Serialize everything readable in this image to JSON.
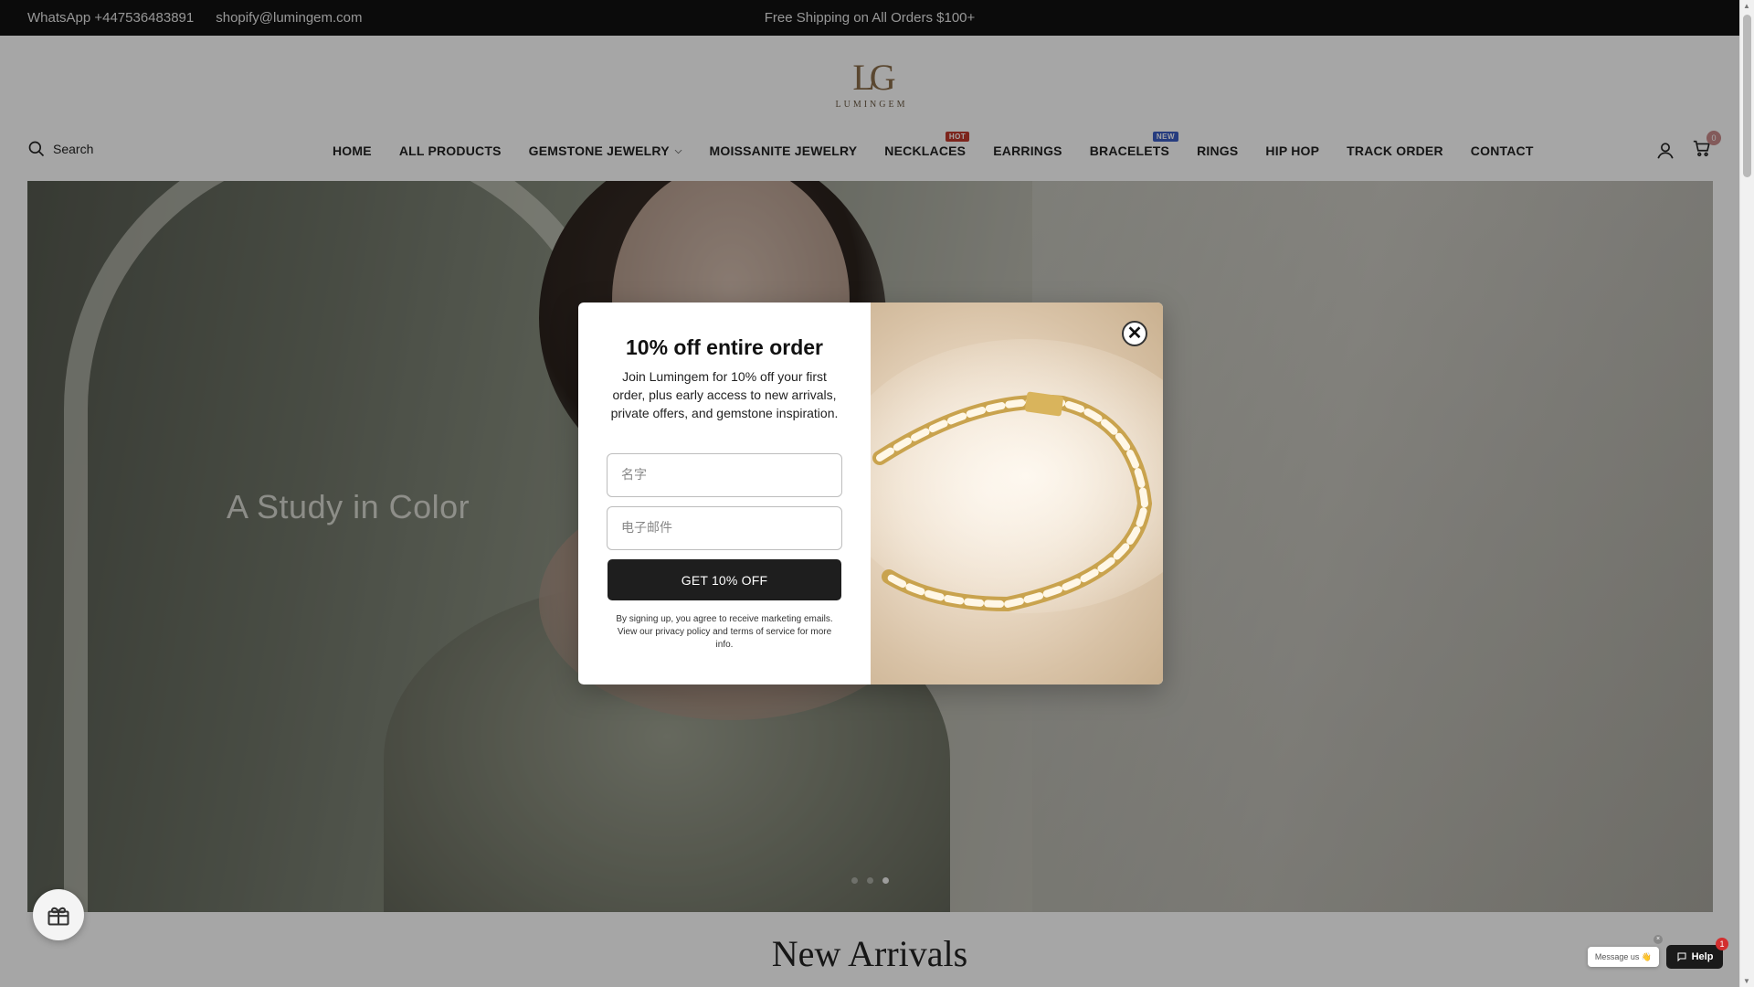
{
  "topbar": {
    "whatsapp": "WhatsApp +447536483891",
    "email": "shopify@lumingem.com",
    "promo": "Free Shipping on All Orders $100+"
  },
  "header": {
    "logo_mark": "LG",
    "logo_word": "LUMINGEM",
    "search_label": "Search",
    "cart_count": "0",
    "nav": [
      {
        "label": "HOME"
      },
      {
        "label": "ALL PRODUCTS"
      },
      {
        "label": "GEMSTONE JEWELRY",
        "dropdown": true
      },
      {
        "label": "MOISSANITE JEWELRY"
      },
      {
        "label": "NECKLACES",
        "badge": "HOT"
      },
      {
        "label": "EARRINGS"
      },
      {
        "label": "BRACELETS",
        "badge": "NEW"
      },
      {
        "label": "RINGS"
      },
      {
        "label": "HIP HOP"
      },
      {
        "label": "TRACK ORDER"
      },
      {
        "label": "CONTACT"
      }
    ]
  },
  "hero": {
    "slogan": "A Study in Color",
    "slides": 3,
    "active_slide": 3
  },
  "popup": {
    "title": "10% off entire order",
    "subtitle": "Join Lumingem for 10% off your first order, plus early access to new arrivals, private offers, and gemstone inspiration.",
    "name_placeholder": "名字",
    "email_placeholder": "电子邮件",
    "cta_label": "GET 10% OFF",
    "legal": "By signing up, you agree to receive marketing emails. View our privacy policy and terms of service for more info.",
    "close_label": "✕"
  },
  "sections": {
    "new_arrivals_title": "New Arrivals"
  },
  "chat": {
    "message_label": "Message us 👋",
    "help_label": "Help",
    "notification_count": "1"
  },
  "colors": {
    "topbar_bg": "#111111",
    "hot_badge": "#c0392b",
    "new_badge": "#3b5cc4",
    "cta_bg": "#1e1e1e"
  }
}
